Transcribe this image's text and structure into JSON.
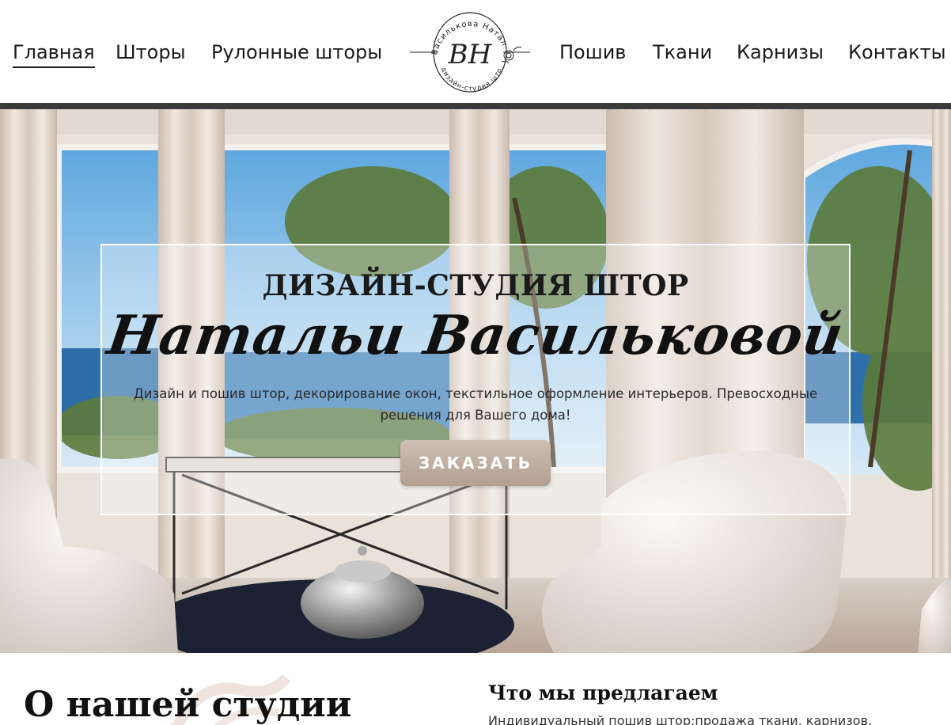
{
  "nav": {
    "left": [
      {
        "label": "Главная",
        "active": true
      },
      {
        "label": "Шторы"
      },
      {
        "label": "Рулонные шторы"
      }
    ],
    "right": [
      {
        "label": "Пошив"
      },
      {
        "label": "Ткани"
      },
      {
        "label": "Карнизы"
      },
      {
        "label": "Контакты"
      }
    ]
  },
  "logo": {
    "top_arc": "Василькова Наталья",
    "monogram": "ВН",
    "bottom_arc": "дизайн-студия штор"
  },
  "hero": {
    "title": "ДИЗАЙН-СТУДИЯ ШТОР",
    "script": "Натальи Васильковой",
    "description": "Дизайн и пошив штор, декорирование окон, текстильное оформление интерьеров. Превосходные решения для Вашего дома!",
    "button": "ЗАКАЗАТЬ"
  },
  "about": {
    "title": "О нашей студии",
    "offer_title": "Что мы предлагаем",
    "offer_text": "Индивидуальный пошив штор;продажа ткани, карнизов,"
  },
  "colors": {
    "text": "#1a1a1a",
    "button": "#b9a798",
    "sky": "#7fb8e0",
    "sea": "#2d6ea8"
  }
}
